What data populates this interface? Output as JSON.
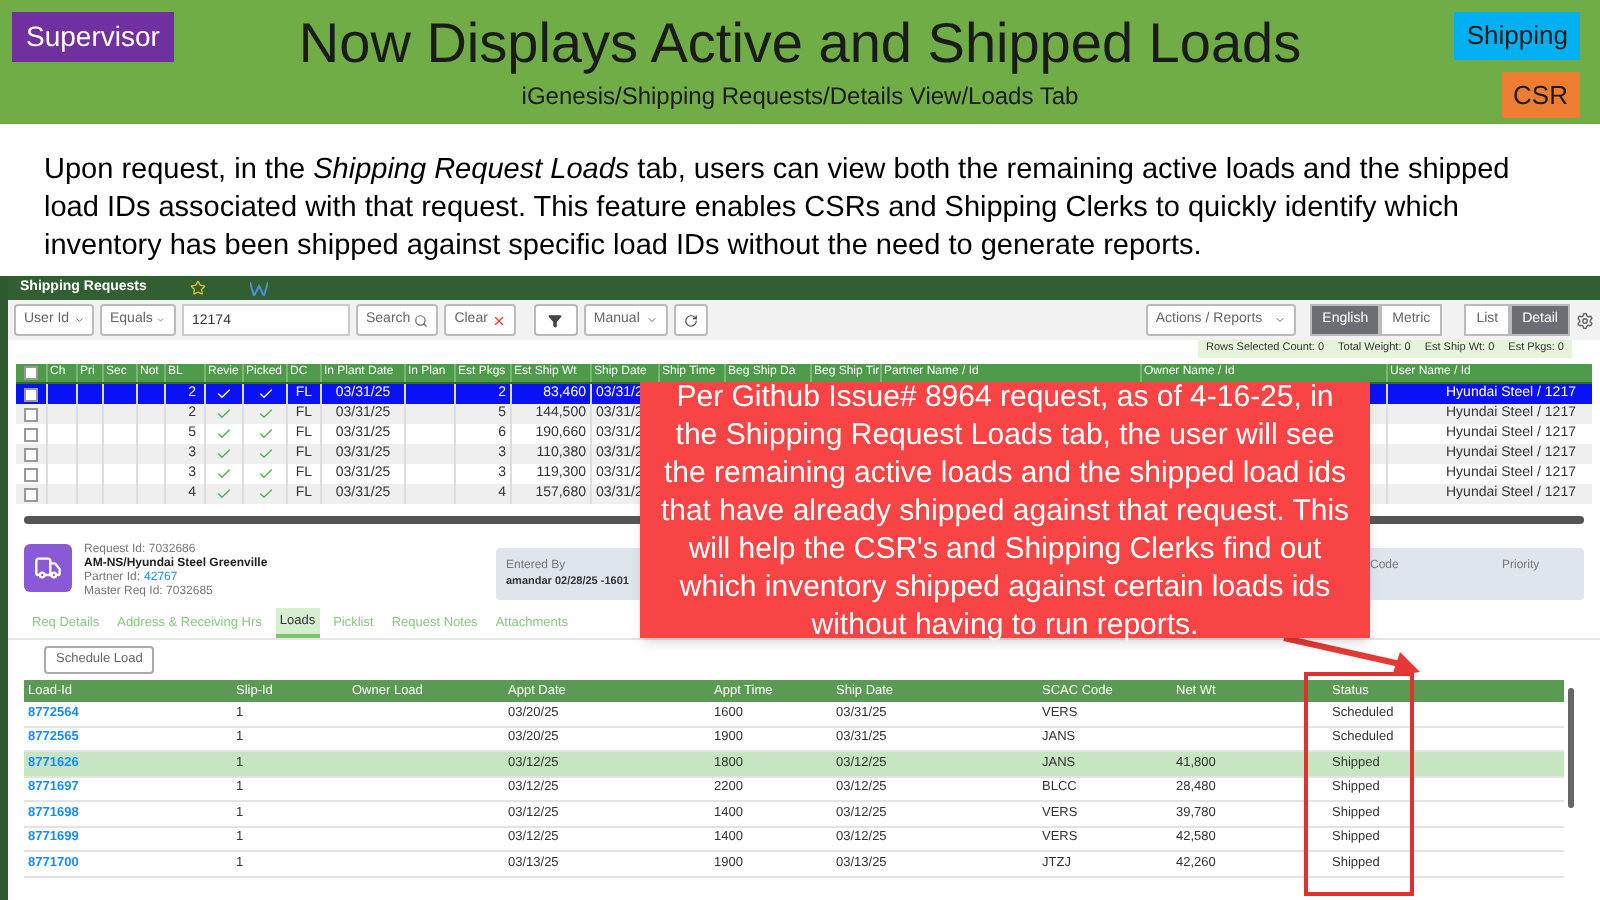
{
  "slide": {
    "role_badge": {
      "label": "Supervisor",
      "color": "#7030a0"
    },
    "title": "Now Displays Active and Shipped Loads",
    "subtitle": "iGenesis/Shipping Requests/Details View/Loads Tab",
    "tags": [
      {
        "label": "Shipping",
        "color": "#00b0f0"
      },
      {
        "label": "CSR",
        "color": "#ed7d31"
      }
    ],
    "description": "Upon request, in the *Shipping Request Loads* tab, users can view both the remaining active loads and the shipped load IDs associated with that request. This feature enables CSRs and Shipping Clerks to quickly identify which inventory has been shipped against specific load IDs without the need to generate reports."
  },
  "app": {
    "title": "Shipping Requests",
    "toolbar": {
      "field_filter": "User Id",
      "operator": "Equals",
      "search_value": "12174",
      "search_button": "Search",
      "clear_button": "Clear",
      "mode": "Manual",
      "actions": "Actions / Reports",
      "units": [
        {
          "label": "English",
          "selected": true
        },
        {
          "label": "Metric",
          "selected": false
        }
      ],
      "views": [
        {
          "label": "List",
          "selected": false
        },
        {
          "label": "Detail",
          "selected": true
        }
      ]
    },
    "summary": [
      "Rows Selected Count: 0",
      "Total Weight: 0",
      "Est Ship Wt: 0",
      "Est Pkgs: 0"
    ],
    "grid": {
      "all_checked": false,
      "columns": [
        "Ch",
        "Pri",
        "Sec",
        "Not",
        "BL",
        "Revie",
        "Picked",
        "DC",
        "In Plant Date",
        "In Plan",
        "Est Pkgs",
        "Est Ship Wt",
        "Ship Date",
        "Ship Time",
        "Beg Ship Da",
        "Beg Ship Tir",
        "Partner Name / Id",
        "Owner Name / Id",
        "User Name / Id"
      ],
      "rows": [
        {
          "selected": true,
          "checked": false,
          "bl": "2",
          "reviewed": true,
          "picked": true,
          "dc": "FL",
          "in_plant_date": "03/31/25",
          "est_pkgs": "2",
          "est_ship_wt": "83,460",
          "ship_date": "03/31/2",
          "user_name": "Hyundai Steel / 1217"
        },
        {
          "selected": false,
          "checked": false,
          "bl": "2",
          "reviewed": true,
          "picked": true,
          "dc": "FL",
          "in_plant_date": "03/31/25",
          "est_pkgs": "5",
          "est_ship_wt": "144,500",
          "ship_date": "03/31/2",
          "user_name": "Hyundai Steel / 1217"
        },
        {
          "selected": false,
          "checked": false,
          "bl": "5",
          "reviewed": true,
          "picked": true,
          "dc": "FL",
          "in_plant_date": "03/31/25",
          "est_pkgs": "6",
          "est_ship_wt": "190,660",
          "ship_date": "03/31/2",
          "user_name": "Hyundai Steel / 1217"
        },
        {
          "selected": false,
          "checked": false,
          "bl": "3",
          "reviewed": true,
          "picked": true,
          "dc": "FL",
          "in_plant_date": "03/31/25",
          "est_pkgs": "3",
          "est_ship_wt": "110,380",
          "ship_date": "03/31/2",
          "user_name": "Hyundai Steel / 1217"
        },
        {
          "selected": false,
          "checked": false,
          "bl": "3",
          "reviewed": true,
          "picked": true,
          "dc": "FL",
          "in_plant_date": "03/31/25",
          "est_pkgs": "3",
          "est_ship_wt": "119,300",
          "ship_date": "03/31/2",
          "user_name": "Hyundai Steel / 1217"
        },
        {
          "selected": false,
          "checked": false,
          "bl": "4",
          "reviewed": true,
          "picked": true,
          "dc": "FL",
          "in_plant_date": "03/31/25",
          "est_pkgs": "4",
          "est_ship_wt": "157,680",
          "ship_date": "03/31/2",
          "user_name": "Hyundai Steel / 1217"
        }
      ]
    },
    "detail": {
      "request_id": "Request Id: 7032686",
      "name": "AM-NS/Hyundai Steel Greenville",
      "partner_label": "Partner Id:",
      "partner_id": "42767",
      "master_req_id": "Master Req Id: 7032685",
      "entered_by_label": "Entered By",
      "entered_by": "amandar 02/28/25 -1601",
      "code_label": "Code",
      "priority_label": "Priority"
    },
    "tabs": [
      {
        "label": "Req Details",
        "selected": false
      },
      {
        "label": "Address & Receiving Hrs",
        "selected": false
      },
      {
        "label": "Loads",
        "selected": true
      },
      {
        "label": "Picklist",
        "selected": false
      },
      {
        "label": "Request Notes",
        "selected": false
      },
      {
        "label": "Attachments",
        "selected": false
      }
    ],
    "schedule_button": "Schedule Load",
    "loads": {
      "columns": [
        "Load-Id",
        "Slip-Id",
        "Owner Load",
        "Appt Date",
        "Appt Time",
        "Ship Date",
        "SCAC Code",
        "Net Wt",
        "Status"
      ],
      "rows": [
        {
          "selected": false,
          "load_id": "8772564",
          "slip_id": "1",
          "appt_date": "03/20/25",
          "appt_time": "1600",
          "ship_date": "03/31/25",
          "scac_code": "VERS",
          "status": "Scheduled"
        },
        {
          "selected": false,
          "load_id": "8772565",
          "slip_id": "1",
          "appt_date": "03/20/25",
          "appt_time": "1900",
          "ship_date": "03/31/25",
          "scac_code": "JANS",
          "status": "Scheduled"
        },
        {
          "selected": true,
          "load_id": "8771626",
          "slip_id": "1",
          "appt_date": "03/12/25",
          "appt_time": "1800",
          "ship_date": "03/12/25",
          "scac_code": "JANS",
          "net_wt": "41,800",
          "status": "Shipped"
        },
        {
          "selected": false,
          "load_id": "8771697",
          "slip_id": "1",
          "appt_date": "03/12/25",
          "appt_time": "2200",
          "ship_date": "03/12/25",
          "scac_code": "BLCC",
          "net_wt": "28,480",
          "status": "Shipped"
        },
        {
          "selected": false,
          "load_id": "8771698",
          "slip_id": "1",
          "appt_date": "03/12/25",
          "appt_time": "1400",
          "ship_date": "03/12/25",
          "scac_code": "VERS",
          "net_wt": "39,780",
          "status": "Shipped"
        },
        {
          "selected": false,
          "load_id": "8771699",
          "slip_id": "1",
          "appt_date": "03/12/25",
          "appt_time": "1400",
          "ship_date": "03/12/25",
          "scac_code": "VERS",
          "net_wt": "42,580",
          "status": "Shipped"
        },
        {
          "selected": false,
          "load_id": "8771700",
          "slip_id": "1",
          "appt_date": "03/13/25",
          "appt_time": "1900",
          "ship_date": "03/13/25",
          "scac_code": "JTZJ",
          "net_wt": "42,260",
          "status": "Shipped"
        }
      ]
    }
  },
  "callout": {
    "text": "Per Github Issue# 8964 request, as of 4-16-25, in the Shipping Request Loads tab, the user will see the remaining active loads and the shipped load ids that have already shipped against that request. This will help the CSR's and Shipping Clerks find out which inventory shipped against certain loads ids without having to run reports."
  }
}
